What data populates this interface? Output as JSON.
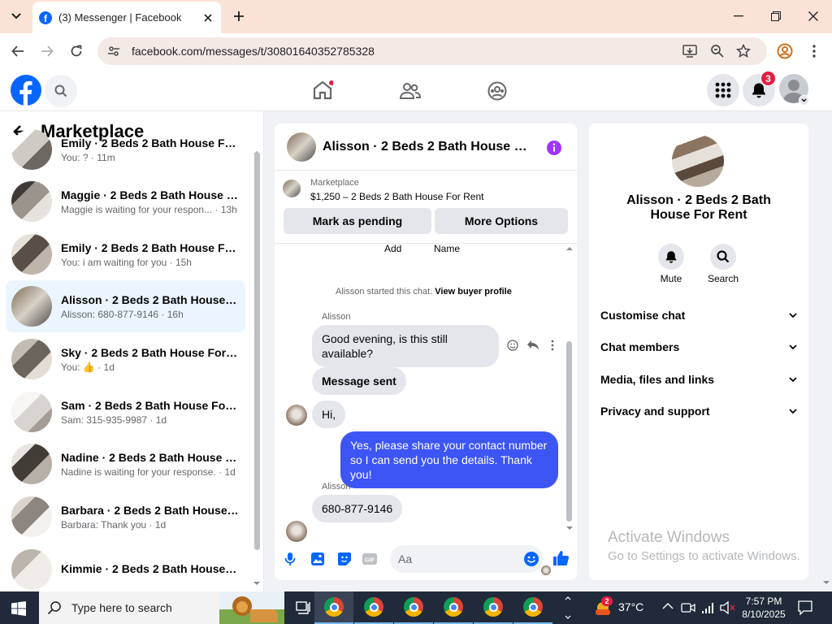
{
  "browser": {
    "tab_title": "(3) Messenger | Facebook",
    "url": "facebook.com/messages/t/30801640352785328"
  },
  "fb_header": {
    "notification_count": "3"
  },
  "left": {
    "title": "Marketplace",
    "conversations": [
      {
        "name": "Emily · 2 Beds 2 Bath House For ...",
        "preview": "You: ? · 11m",
        "selected": false
      },
      {
        "name": "Maggie · 2 Beds 2 Bath House F...",
        "preview": "Maggie is waiting for your respon... · 13h",
        "selected": false
      },
      {
        "name": "Emily · 2 Beds 2 Bath House For ...",
        "preview": "You: i am waiting for you · 15h",
        "selected": false
      },
      {
        "name": "Alisson · 2 Beds 2 Bath House F...",
        "preview": "Alisson: 680-877-9146 · 16h",
        "selected": true
      },
      {
        "name": "Sky · 2 Beds 2 Bath House For R...",
        "preview": "You: 👍 · 1d",
        "selected": false
      },
      {
        "name": "Sam · 2 Beds 2 Bath House For ...",
        "preview": "Sam: 315-935-9987 · 1d",
        "selected": false
      },
      {
        "name": "Nadine · 2 Beds 2 Bath House F...",
        "preview": "Nadine is waiting for your response. · 1d",
        "selected": false
      },
      {
        "name": "Barbara · 2 Beds 2 Bath House F...",
        "preview": "Barbara: Thank you · 1d",
        "selected": false
      },
      {
        "name": "Kimmie · 2 Beds 2 Bath House F...",
        "preview": "",
        "selected": false
      }
    ]
  },
  "chat": {
    "title": "Alisson · 2 Beds 2 Bath House For R...",
    "listing_source": "Marketplace",
    "listing_title": "$1,250 – 2 Beds 2 Bath House For Rent",
    "btn_pending": "Mark as pending",
    "btn_more": "More Options",
    "col_add": "Add",
    "col_name": "Name",
    "started_text": "Alisson started this chat.",
    "view_profile": "View buyer profile",
    "sender_1": "Alisson",
    "msg_1": "Good evening, is this still available?",
    "msg_2": "Message sent",
    "msg_3": "Hi,",
    "msg_me": "Yes, please share your contact number so I can send you the details. Thank you!",
    "sender_2": "Alisson",
    "msg_4": "680-877-9146",
    "input_placeholder": "Aa"
  },
  "right": {
    "name": "Alisson · 2 Beds 2 Bath House For Rent",
    "mute": "Mute",
    "search": "Search",
    "sections": [
      "Customise chat",
      "Chat members",
      "Media, files and links",
      "Privacy and support"
    ],
    "watermark_title": "Activate Windows",
    "watermark_sub": "Go to Settings to activate Windows."
  },
  "taskbar": {
    "search_placeholder": "Type here to search",
    "temperature": "37°C",
    "time": "7:57 PM",
    "date": "8/10/2025",
    "chrome_badge": "2"
  },
  "colors": {
    "fb_blue": "#0866ff",
    "my_bubble": "#3d55f5",
    "purple_info": "#a033ff"
  }
}
